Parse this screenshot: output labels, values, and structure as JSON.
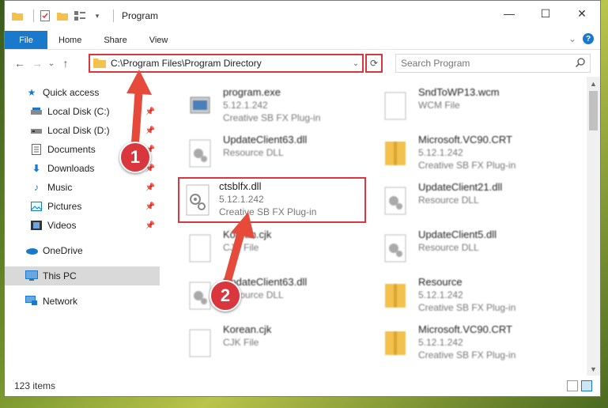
{
  "window": {
    "title": "Program",
    "controls": {
      "minimize": "—",
      "maximize": "☐",
      "close": "✕"
    }
  },
  "ribbon": {
    "tabs": [
      "File",
      "Home",
      "Share",
      "View"
    ],
    "expand": "⌄",
    "help": "?"
  },
  "nav": {
    "back": "←",
    "forward": "→",
    "recent": "⌄",
    "up": "↑",
    "path": "C:\\Program Files\\Program Directory",
    "dropdown": "⌄",
    "refresh": "⟳",
    "search_placeholder": "Search Program"
  },
  "sidebar": {
    "items": [
      {
        "label": "Quick access",
        "icon": "star-icon",
        "pinned": false
      },
      {
        "label": "Local Disk (C:)",
        "icon": "drive-icon",
        "pinned": true
      },
      {
        "label": "Local Disk (D:)",
        "icon": "drive-icon",
        "pinned": true
      },
      {
        "label": "Documents",
        "icon": "documents-icon",
        "pinned": true
      },
      {
        "label": "Downloads",
        "icon": "downloads-icon",
        "pinned": true
      },
      {
        "label": "Music",
        "icon": "music-icon",
        "pinned": true
      },
      {
        "label": "Pictures",
        "icon": "pictures-icon",
        "pinned": true
      },
      {
        "label": "Videos",
        "icon": "videos-icon",
        "pinned": true
      },
      {
        "label": "OneDrive",
        "icon": "onedrive-icon",
        "pinned": false
      },
      {
        "label": "This PC",
        "icon": "this-pc-icon",
        "pinned": false
      },
      {
        "label": "Network",
        "icon": "network-icon",
        "pinned": false
      }
    ]
  },
  "files": {
    "left": [
      {
        "name": "program.exe",
        "line2": "5.12.1.242",
        "line3": "Creative SB FX Plug-in",
        "icon": "exe-icon"
      },
      {
        "name": "UpdateClient63.dll",
        "line2": "Resource DLL",
        "line3": "",
        "icon": "dll-icon"
      },
      {
        "name": "Korean.cjk",
        "line2": "CJK File",
        "line3": "",
        "icon": "file-icon"
      },
      {
        "name": "UpdateClient63.dll",
        "line2": "Resource DLL",
        "line3": "",
        "icon": "dll-icon"
      },
      {
        "name": "Korean.cjk",
        "line2": "CJK File",
        "line3": "",
        "icon": "file-icon"
      }
    ],
    "right": [
      {
        "name": "SndToWP13.wcm",
        "line2": "WCM File",
        "line3": "",
        "icon": "file-icon"
      },
      {
        "name": "Microsoft.VC90.CRT",
        "line2": "5.12.1.242",
        "line3": "Creative SB FX Plug-in",
        "icon": "folder-zip-icon"
      },
      {
        "name": "UpdateClient21.dll",
        "line2": "Resource DLL",
        "line3": "",
        "icon": "dll-icon"
      },
      {
        "name": "UpdateClient5.dll",
        "line2": "Resource DLL",
        "line3": "",
        "icon": "dll-icon"
      },
      {
        "name": "Resource",
        "line2": "5.12.1.242",
        "line3": "Creative SB FX Plug-in",
        "icon": "folder-zip-icon"
      },
      {
        "name": "Microsoft.VC90.CRT",
        "line2": "5.12.1.242",
        "line3": "Creative SB FX Plug-in",
        "icon": "folder-zip-icon"
      }
    ],
    "highlighted": {
      "name": "ctsblfx.dll",
      "line2": "5.12.1.242",
      "line3": "Creative SB FX Plug-in",
      "icon": "dll-icon"
    }
  },
  "status": {
    "count": "123 items"
  },
  "callouts": {
    "one": "1",
    "two": "2"
  },
  "colors": {
    "accent": "#1979ca",
    "highlight": "#d9363e"
  }
}
